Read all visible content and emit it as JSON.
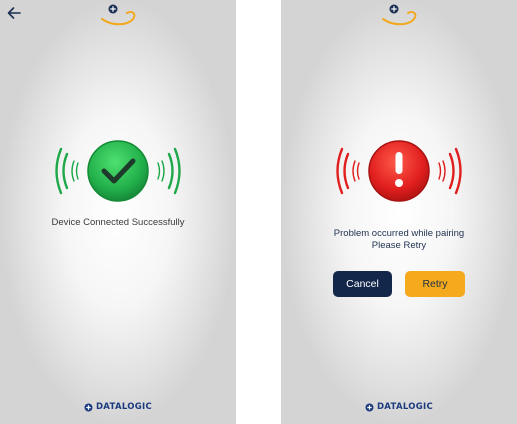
{
  "success_screen": {
    "message": "Device Connected Successfully",
    "brand": "DATALOGIC",
    "icons": {
      "back": "back-arrow-icon",
      "status": "check-icon",
      "logo": "app-logo-icon"
    },
    "colors": {
      "status": "#22b04b",
      "waves": "#1ea84a"
    }
  },
  "error_screen": {
    "message_line1": "Problem occurred while pairing",
    "message_line2": "Please Retry",
    "cancel_label": "Cancel",
    "retry_label": "Retry",
    "brand": "DATALOGIC",
    "icons": {
      "status": "exclamation-icon",
      "logo": "app-logo-icon"
    },
    "colors": {
      "status": "#e01e1e",
      "waves": "#e01e1e",
      "cancel": "#12274a",
      "retry": "#f5a91c"
    }
  }
}
